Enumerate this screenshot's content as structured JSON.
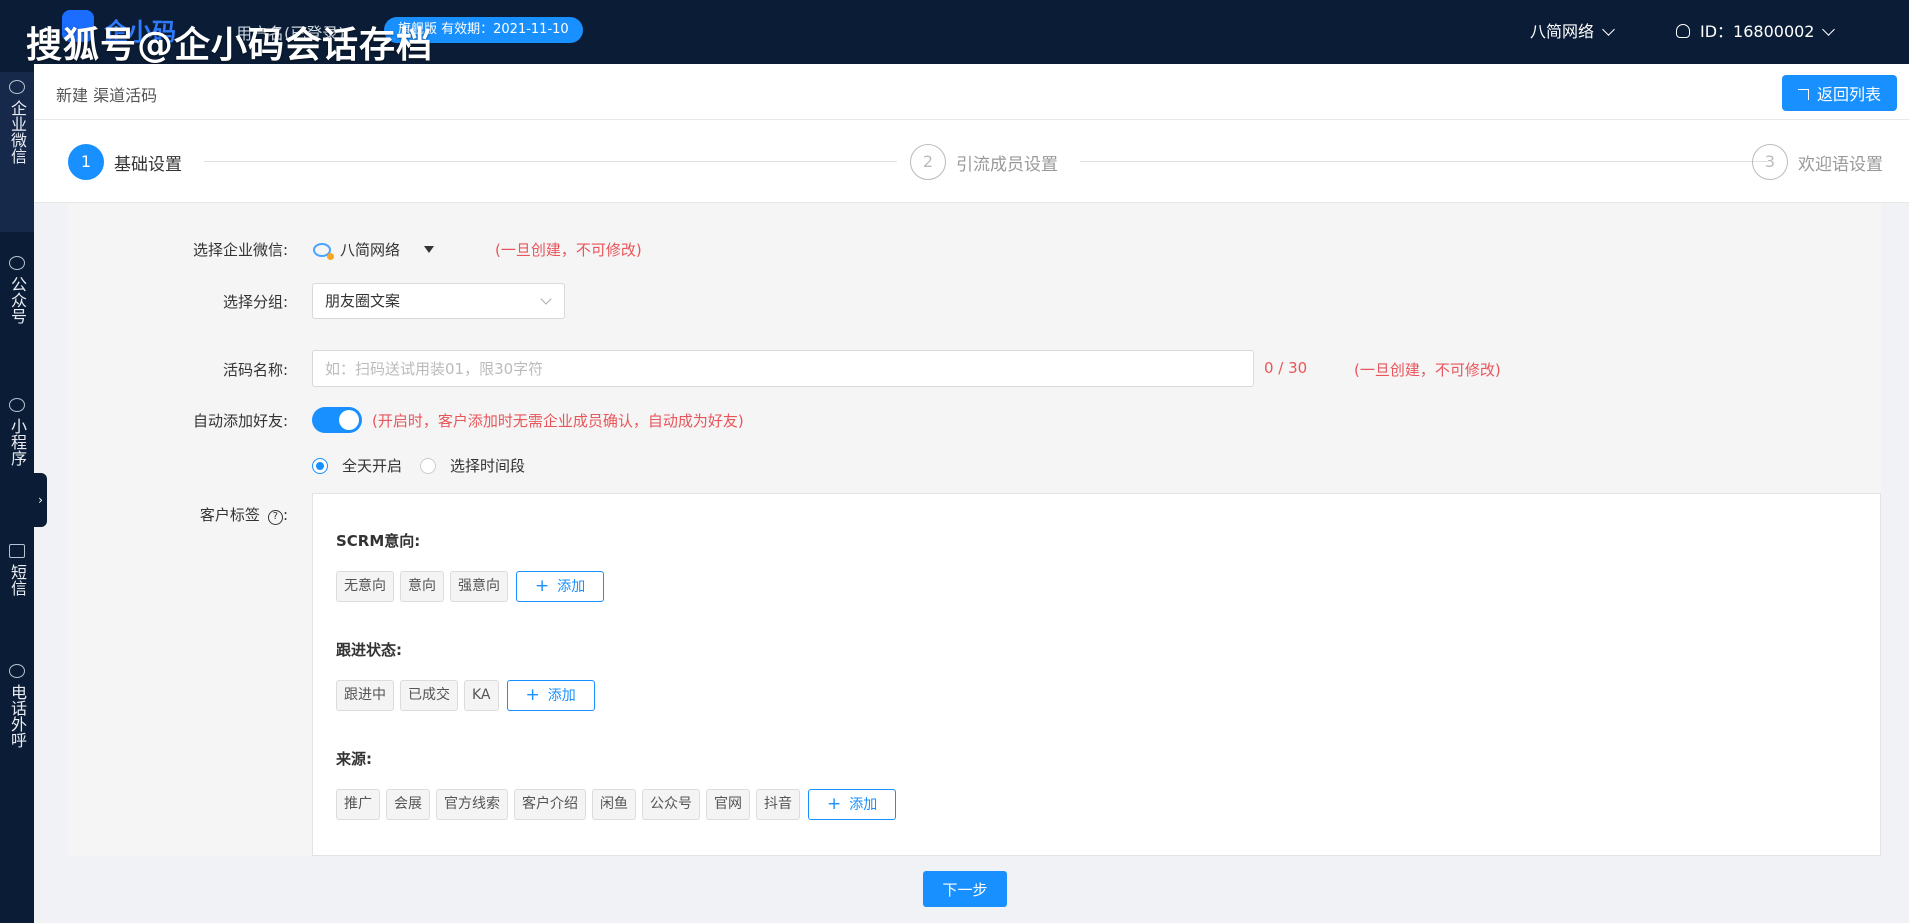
{
  "topbar": {
    "logo_text": "企小码",
    "watermark": "搜狐号@企小码会话存档",
    "user_label": "用户名(已登录)",
    "version_badge": "旗舰版 有效期：2021-11-10",
    "company": "八简网络",
    "account": "ID：16800002"
  },
  "sidebar": {
    "items": [
      {
        "label": "企业微信",
        "icon": "chat-bubble-icon"
      },
      {
        "label": "公众号",
        "icon": "wechat-icon"
      },
      {
        "label": "小程序",
        "icon": "mini-program-icon"
      },
      {
        "label": "短信",
        "icon": "mail-icon"
      },
      {
        "label": "电话外呼",
        "icon": "phone-icon"
      }
    ],
    "collapse": "›"
  },
  "header": {
    "title": "新建 渠道活码",
    "back_label": "返回列表"
  },
  "steps": [
    {
      "num": "1",
      "title": "基础设置"
    },
    {
      "num": "2",
      "title": "引流成员设置"
    },
    {
      "num": "3",
      "title": "欢迎语设置"
    }
  ],
  "form": {
    "corp_label": "选择企业微信:",
    "corp_value": "八简网络",
    "corp_hint": "(一旦创建，不可修改)",
    "group_label": "选择分组:",
    "group_value": "朋友圈文案",
    "name_label": "活码名称:",
    "name_placeholder": "如：扫码送试用装01，限30字符",
    "name_counter": "0 / 30",
    "name_hint": "(一旦创建，不可修改)",
    "auto_add_label": "自动添加好友:",
    "auto_add_hint": "(开启时，客户添加时无需企业成员确认，自动成为好友)",
    "radio_all_day": "全天开启",
    "radio_time_range": "选择时间段",
    "tags_label": "客户标签",
    "tags_label_suffix": ":",
    "help_glyph": "?"
  },
  "tag_groups": [
    {
      "title": "SCRM意向:",
      "tags": [
        "无意向",
        "意向",
        "强意向"
      ]
    },
    {
      "title": "跟进状态:",
      "tags": [
        "跟进中",
        "已成交",
        "KA"
      ]
    },
    {
      "title": "来源:",
      "tags": [
        "推广",
        "会展",
        "官方线索",
        "客户介绍",
        "闲鱼",
        "公众号",
        "官网",
        "抖音"
      ]
    }
  ],
  "add_label": "添加",
  "plus_glyph": "+",
  "footer": {
    "next_label": "下一步"
  },
  "colors": {
    "primary": "#1890ff",
    "topbar_bg": "#0b1d36",
    "hint_red": "#e8565b"
  }
}
